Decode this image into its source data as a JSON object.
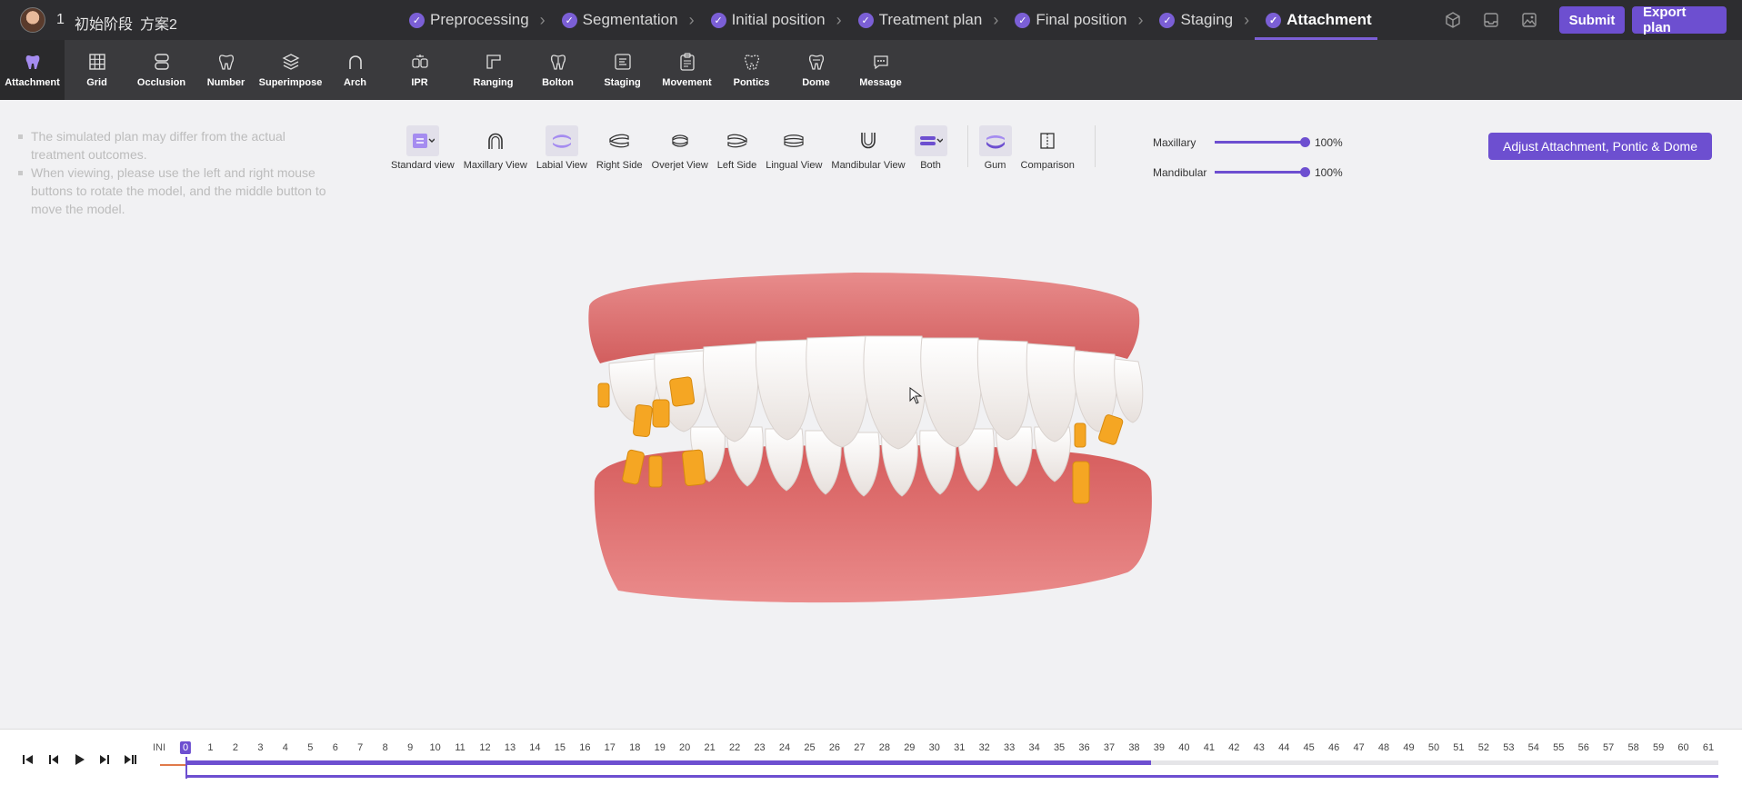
{
  "header": {
    "case_id": "1",
    "case_name": "初始阶段",
    "plan_name": "方案2",
    "steps": [
      {
        "label": "Preprocessing",
        "done": true
      },
      {
        "label": "Segmentation",
        "done": true
      },
      {
        "label": "Initial position",
        "done": true
      },
      {
        "label": "Treatment plan",
        "done": true
      },
      {
        "label": "Final position",
        "done": true
      },
      {
        "label": "Staging",
        "done": true
      },
      {
        "label": "Attachment",
        "done": true,
        "active": true
      }
    ],
    "submit_label": "Submit",
    "export_label": "Export plan"
  },
  "toolbar": {
    "items": [
      {
        "label": "Attachment",
        "icon": "tooth-icon",
        "active": true
      },
      {
        "label": "Grid",
        "icon": "grid-icon"
      },
      {
        "label": "Occlusion",
        "icon": "occlusion-icon"
      },
      {
        "label": "Number",
        "icon": "number-icon"
      },
      {
        "label": "Superimpose",
        "icon": "layers-icon"
      },
      {
        "label": "Arch",
        "icon": "arch-icon"
      },
      {
        "label": "IPR",
        "icon": "ipr-icon"
      },
      {
        "label": "Ranging",
        "icon": "ranging-icon"
      },
      {
        "label": "Bolton",
        "icon": "bolton-icon"
      },
      {
        "label": "Staging",
        "icon": "staging-icon"
      },
      {
        "label": "Movement",
        "icon": "clipboard-icon"
      },
      {
        "label": "Pontics",
        "icon": "pontic-icon"
      },
      {
        "label": "Dome",
        "icon": "dome-icon"
      },
      {
        "label": "Message",
        "icon": "message-icon"
      }
    ]
  },
  "tips": [
    "The simulated plan may differ from the actual treatment outcomes.",
    "When viewing, please use the left and right mouse buttons to rotate the model, and the middle button to move the model."
  ],
  "views": {
    "items": [
      {
        "label": "Standard view",
        "icon": "standard-view-icon",
        "selected": true
      },
      {
        "label": "Maxillary View",
        "icon": "maxillary-icon"
      },
      {
        "label": "Labial View",
        "icon": "labial-icon",
        "selected": true
      },
      {
        "label": "Right Side",
        "icon": "right-side-icon"
      },
      {
        "label": "Overjet View",
        "icon": "overjet-icon"
      },
      {
        "label": "Left Side",
        "icon": "left-side-icon"
      },
      {
        "label": "Lingual View",
        "icon": "lingual-icon"
      },
      {
        "label": "Mandibular View",
        "icon": "mandibular-icon"
      },
      {
        "label": "Both",
        "icon": "both-icon",
        "selected": true
      }
    ],
    "extra": [
      {
        "label": "Gum",
        "icon": "gum-icon",
        "selected": true
      },
      {
        "label": "Comparison",
        "icon": "comparison-icon"
      }
    ]
  },
  "opacity": {
    "maxillary_label": "Maxillary",
    "maxillary_value": "100%",
    "mandibular_label": "Mandibular",
    "mandibular_value": "100%"
  },
  "adjust_label": "Adjust Attachment, Pontic & Dome",
  "timeline": {
    "ini_label": "INI",
    "current_step": "0",
    "max_step": 61,
    "progress": 0.63
  },
  "colors": {
    "accent": "#6d4fd0",
    "topbar": "#2d2d30",
    "toolbar": "#3a3a3d",
    "attachment": "#f5a623",
    "gum": "#e06a6a"
  }
}
